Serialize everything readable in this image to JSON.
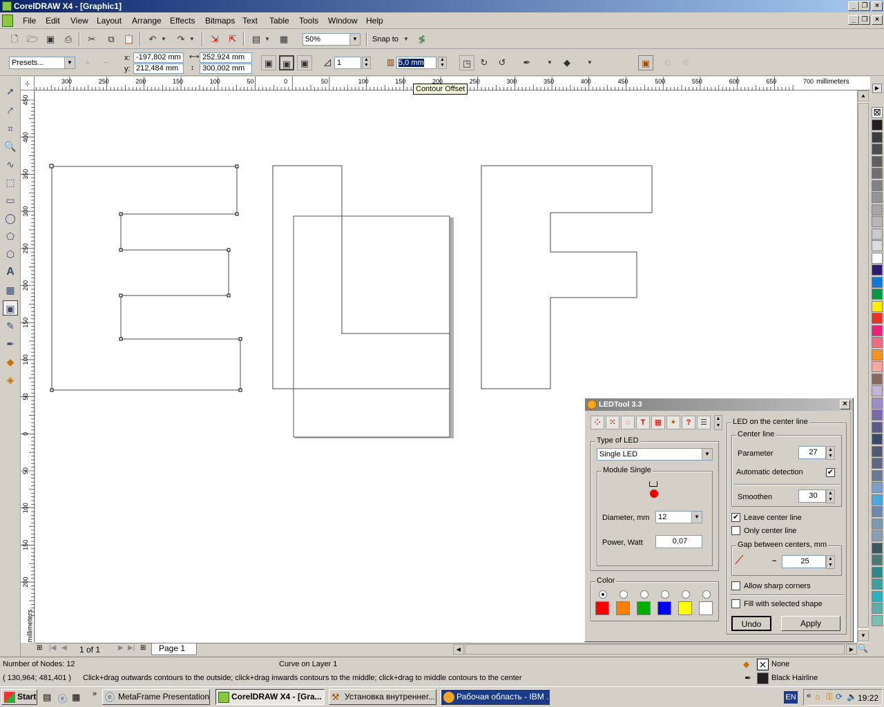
{
  "window": {
    "title": "CorelDRAW X4 - [Graphic1]"
  },
  "menu": [
    "File",
    "Edit",
    "View",
    "Layout",
    "Arrange",
    "Effects",
    "Bitmaps",
    "Text",
    "Table",
    "Tools",
    "Window",
    "Help"
  ],
  "toolbar1": {
    "zoom": "50%",
    "snap_to": "Snap to"
  },
  "toolbar2": {
    "presets": "Presets...",
    "x_label": "x:",
    "x": "-197,802 mm",
    "y_label": "y:",
    "y": "212,484 mm",
    "width": "252,924 mm",
    "height": "300,002 mm",
    "steps": "1",
    "offset": "5,0 mm"
  },
  "tooltip": "Contour Offset",
  "ruler": {
    "top_ticks": [
      "300",
      "250",
      "200",
      "150",
      "100",
      "50",
      "0",
      "50",
      "100",
      "150",
      "200",
      "250",
      "300",
      "350",
      "400",
      "450",
      "500",
      "550",
      "600",
      "650",
      "700"
    ],
    "top_unit": "millimeters",
    "left_ticks": [
      "450",
      "400",
      "350",
      "300",
      "250",
      "200",
      "150",
      "100",
      "50",
      "0",
      "50",
      "100",
      "150",
      "200"
    ],
    "left_unit": "millimeters"
  },
  "page_nav": {
    "pages": "1 of 1",
    "tab": "Page 1"
  },
  "status": {
    "nodes": "Number of Nodes: 12",
    "object": "Curve on Layer 1",
    "coords": "( 130,964; 481,401 )",
    "hint": "Click+drag outwards contours to the outside; click+drag inwards contours to the middle; click+drag to middle contours to the center",
    "fill": "None",
    "outline": "Black  Hairline"
  },
  "led": {
    "title": "LEDTool 3.3",
    "type_label": "Type of LED",
    "type_value": "Single LED",
    "module_label": "Module Single",
    "diameter_label": "Diameter, mm",
    "diameter": "12",
    "power_label": "Power, Watt",
    "power": "0,07",
    "color_label": "Color",
    "colors": [
      "#ff0000",
      "#ff8000",
      "#00b000",
      "#0000ff",
      "#ffff00",
      "#ffffff"
    ],
    "center_group": "LED on the center line",
    "center_line": "Center line",
    "parameter_label": "Parameter",
    "parameter": "27",
    "auto_label": "Automatic detection",
    "smoothen_label": "Smoothen",
    "smoothen": "30",
    "leave_label": "Leave center line",
    "only_label": "Only center line",
    "gap_label": "Gap between centers, mm",
    "gap_approx": "~",
    "gap": "25",
    "sharp_label": "Allow sharp corners",
    "fill_label": "Fill with selected shape",
    "undo": "Undo",
    "apply": "Apply"
  },
  "taskbar": {
    "start": "Start",
    "tasks": [
      "MetaFrame Presentation...",
      "CorelDRAW X4 - [Gra...",
      "Установка внутреннег...",
      "Рабочая область - IBM ..."
    ],
    "lang": "EN",
    "clock": "19:22"
  },
  "colors": {
    "accent": "#0a246a",
    "selection": "#0a246a"
  }
}
